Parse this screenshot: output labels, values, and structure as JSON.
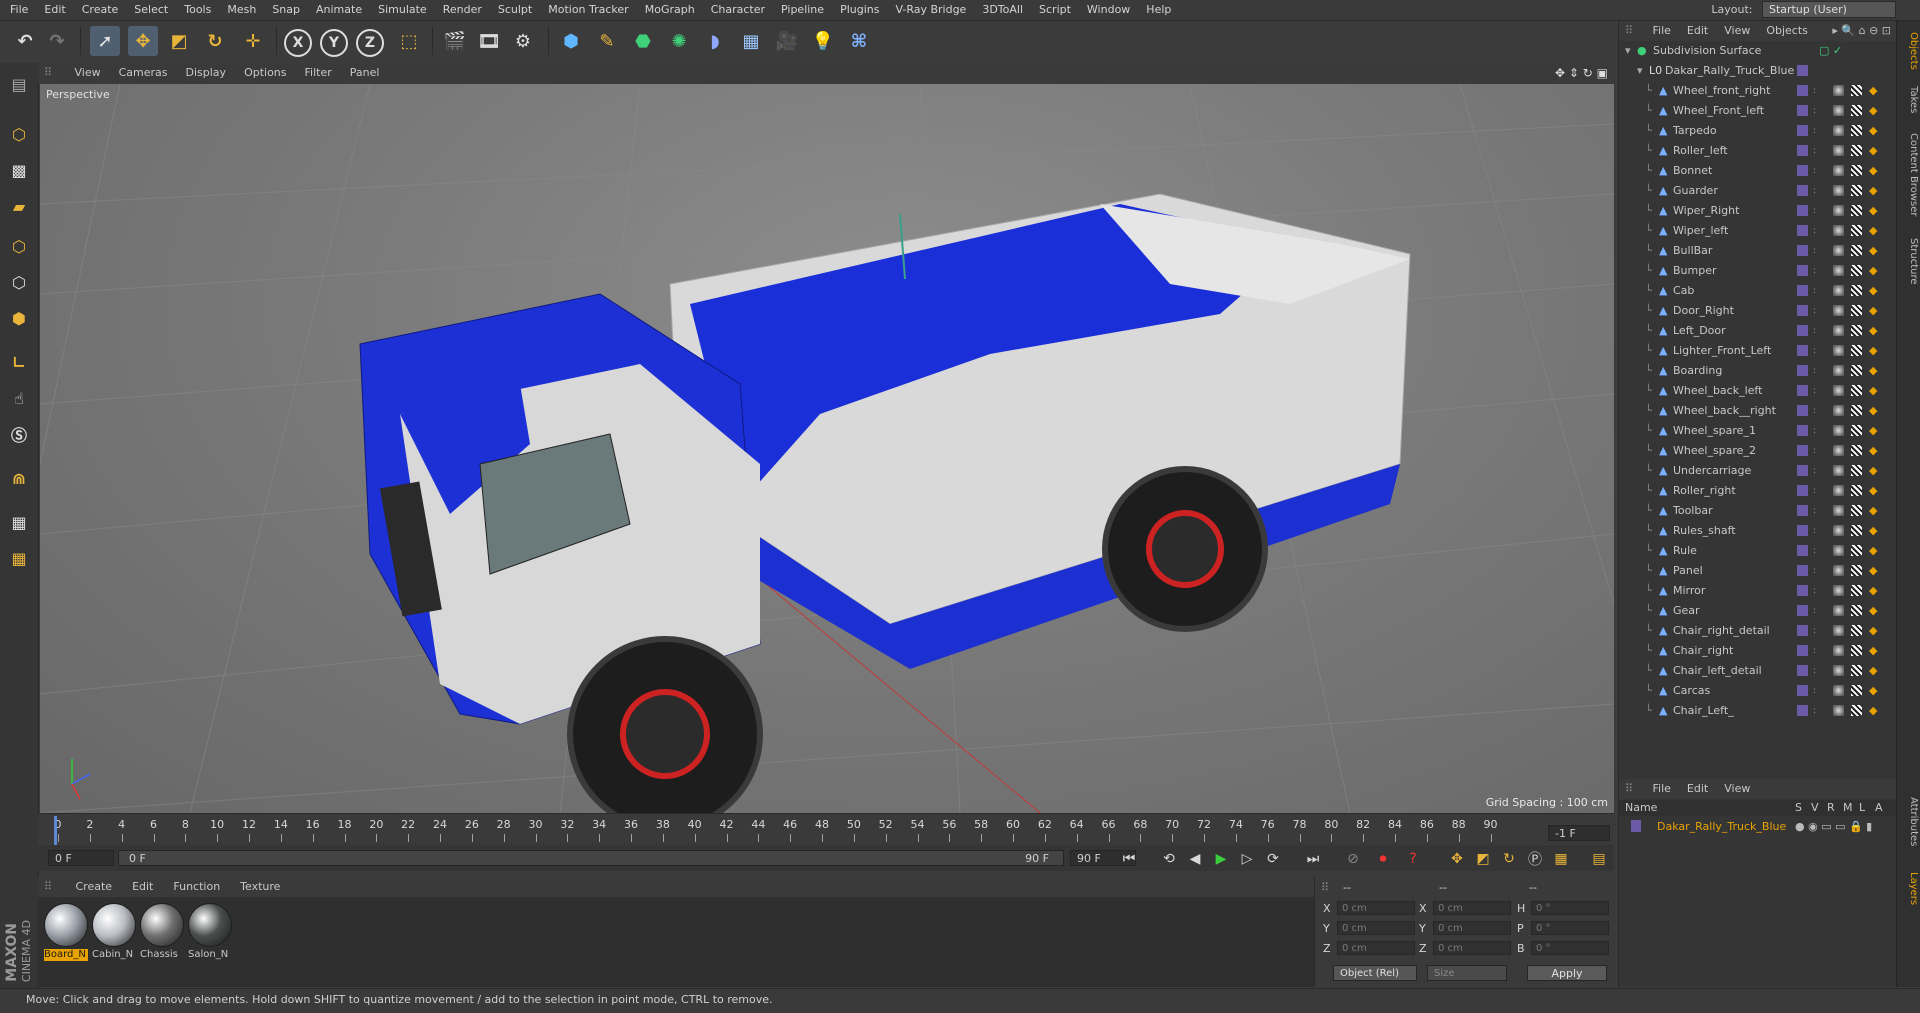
{
  "menubar": {
    "items": [
      "File",
      "Edit",
      "Create",
      "Select",
      "Tools",
      "Mesh",
      "Snap",
      "Animate",
      "Simulate",
      "Render",
      "Sculpt",
      "Motion Tracker",
      "MoGraph",
      "Character",
      "Pipeline",
      "Plugins",
      "V-Ray Bridge",
      "3DToAll",
      "Script",
      "Window",
      "Help"
    ],
    "layout_label": "Layout:",
    "layout_value": "Startup (User)"
  },
  "toolbar": {
    "axis_x": "X",
    "axis_y": "Y",
    "axis_z": "Z"
  },
  "viewport": {
    "menu": [
      "View",
      "Cameras",
      "Display",
      "Options",
      "Filter",
      "Panel"
    ],
    "label": "Perspective",
    "grid_spacing": "Grid Spacing : 100 cm"
  },
  "timeline": {
    "ticks": [
      "0",
      "2",
      "4",
      "6",
      "8",
      "10",
      "12",
      "14",
      "16",
      "18",
      "20",
      "22",
      "24",
      "26",
      "28",
      "30",
      "32",
      "34",
      "36",
      "38",
      "40",
      "42",
      "44",
      "46",
      "48",
      "50",
      "52",
      "54",
      "56",
      "58",
      "60",
      "62",
      "64",
      "66",
      "68",
      "70",
      "72",
      "74",
      "76",
      "78",
      "80",
      "82",
      "84",
      "86",
      "88",
      "90"
    ],
    "current_field": "-1 F",
    "start_field": "0 F",
    "slider_start": "0 F",
    "slider_end": "90 F",
    "end_field": "90 F"
  },
  "materials": {
    "menu": [
      "Create",
      "Edit",
      "Function",
      "Texture"
    ],
    "items": [
      {
        "name": "Board_N",
        "color": "#9aa0a8",
        "selected": true
      },
      {
        "name": "Cabin_N",
        "color": "#b9bcc2",
        "selected": false
      },
      {
        "name": "Chassis",
        "color": "#6f6f6f",
        "selected": false
      },
      {
        "name": "Salon_N",
        "color": "#4a4f4e",
        "selected": false
      }
    ]
  },
  "coords": {
    "header": [
      "--",
      "--",
      "--"
    ],
    "rows": [
      {
        "a": "X",
        "av": "0 cm",
        "b": "X",
        "bv": "0 cm",
        "c": "H",
        "cv": "0 °"
      },
      {
        "a": "Y",
        "av": "0 cm",
        "b": "Y",
        "bv": "0 cm",
        "c": "P",
        "cv": "0 °"
      },
      {
        "a": "Z",
        "av": "0 cm",
        "b": "Z",
        "bv": "0 cm",
        "c": "B",
        "cv": "0 °"
      }
    ],
    "mode": "Object (Rel)",
    "size": "Size",
    "apply": "Apply"
  },
  "objects": {
    "menu": [
      "File",
      "Edit",
      "View",
      "Objects"
    ],
    "root": "Subdivision Surface",
    "group": "Dakar_Rally_Truck_Blue",
    "children": [
      "Wheel_front_right",
      "Wheel_Front_left",
      "Tarpedo",
      "Roller_left",
      "Bonnet",
      "Guarder",
      "Wiper_Right",
      "Wiper_left",
      "BullBar",
      "Bumper",
      "Cab",
      "Door_Right",
      "Left_Door",
      "Lighter_Front_Left",
      "Boarding",
      "Wheel_back_left",
      "Wheel_back__right",
      "Wheel_spare_1",
      "Wheel_spare_2",
      "Undercarriage",
      "Roller_right",
      "Toolbar",
      "Rules_shaft",
      "Rule",
      "Panel",
      "Mirror",
      "Gear",
      "Chair_right_detail",
      "Chair_right",
      "Chair_left_detail",
      "Carcas",
      "Chair_Left_"
    ]
  },
  "layers": {
    "menu": [
      "File",
      "Edit",
      "View"
    ],
    "columns": [
      "Name",
      "S",
      "V",
      "R",
      "M",
      "L",
      "A"
    ],
    "item": "Dakar_Rally_Truck_Blue"
  },
  "sidetabs": [
    "Objects",
    "Takes",
    "Content Browser",
    "Structure",
    "Attributes",
    "Layers"
  ],
  "brand": {
    "maxon": "MAXON",
    "product": "CINEMA 4D"
  },
  "status": "Move: Click and drag to move elements. Hold down SHIFT to quantize movement / add to the selection in point mode, CTRL to remove."
}
